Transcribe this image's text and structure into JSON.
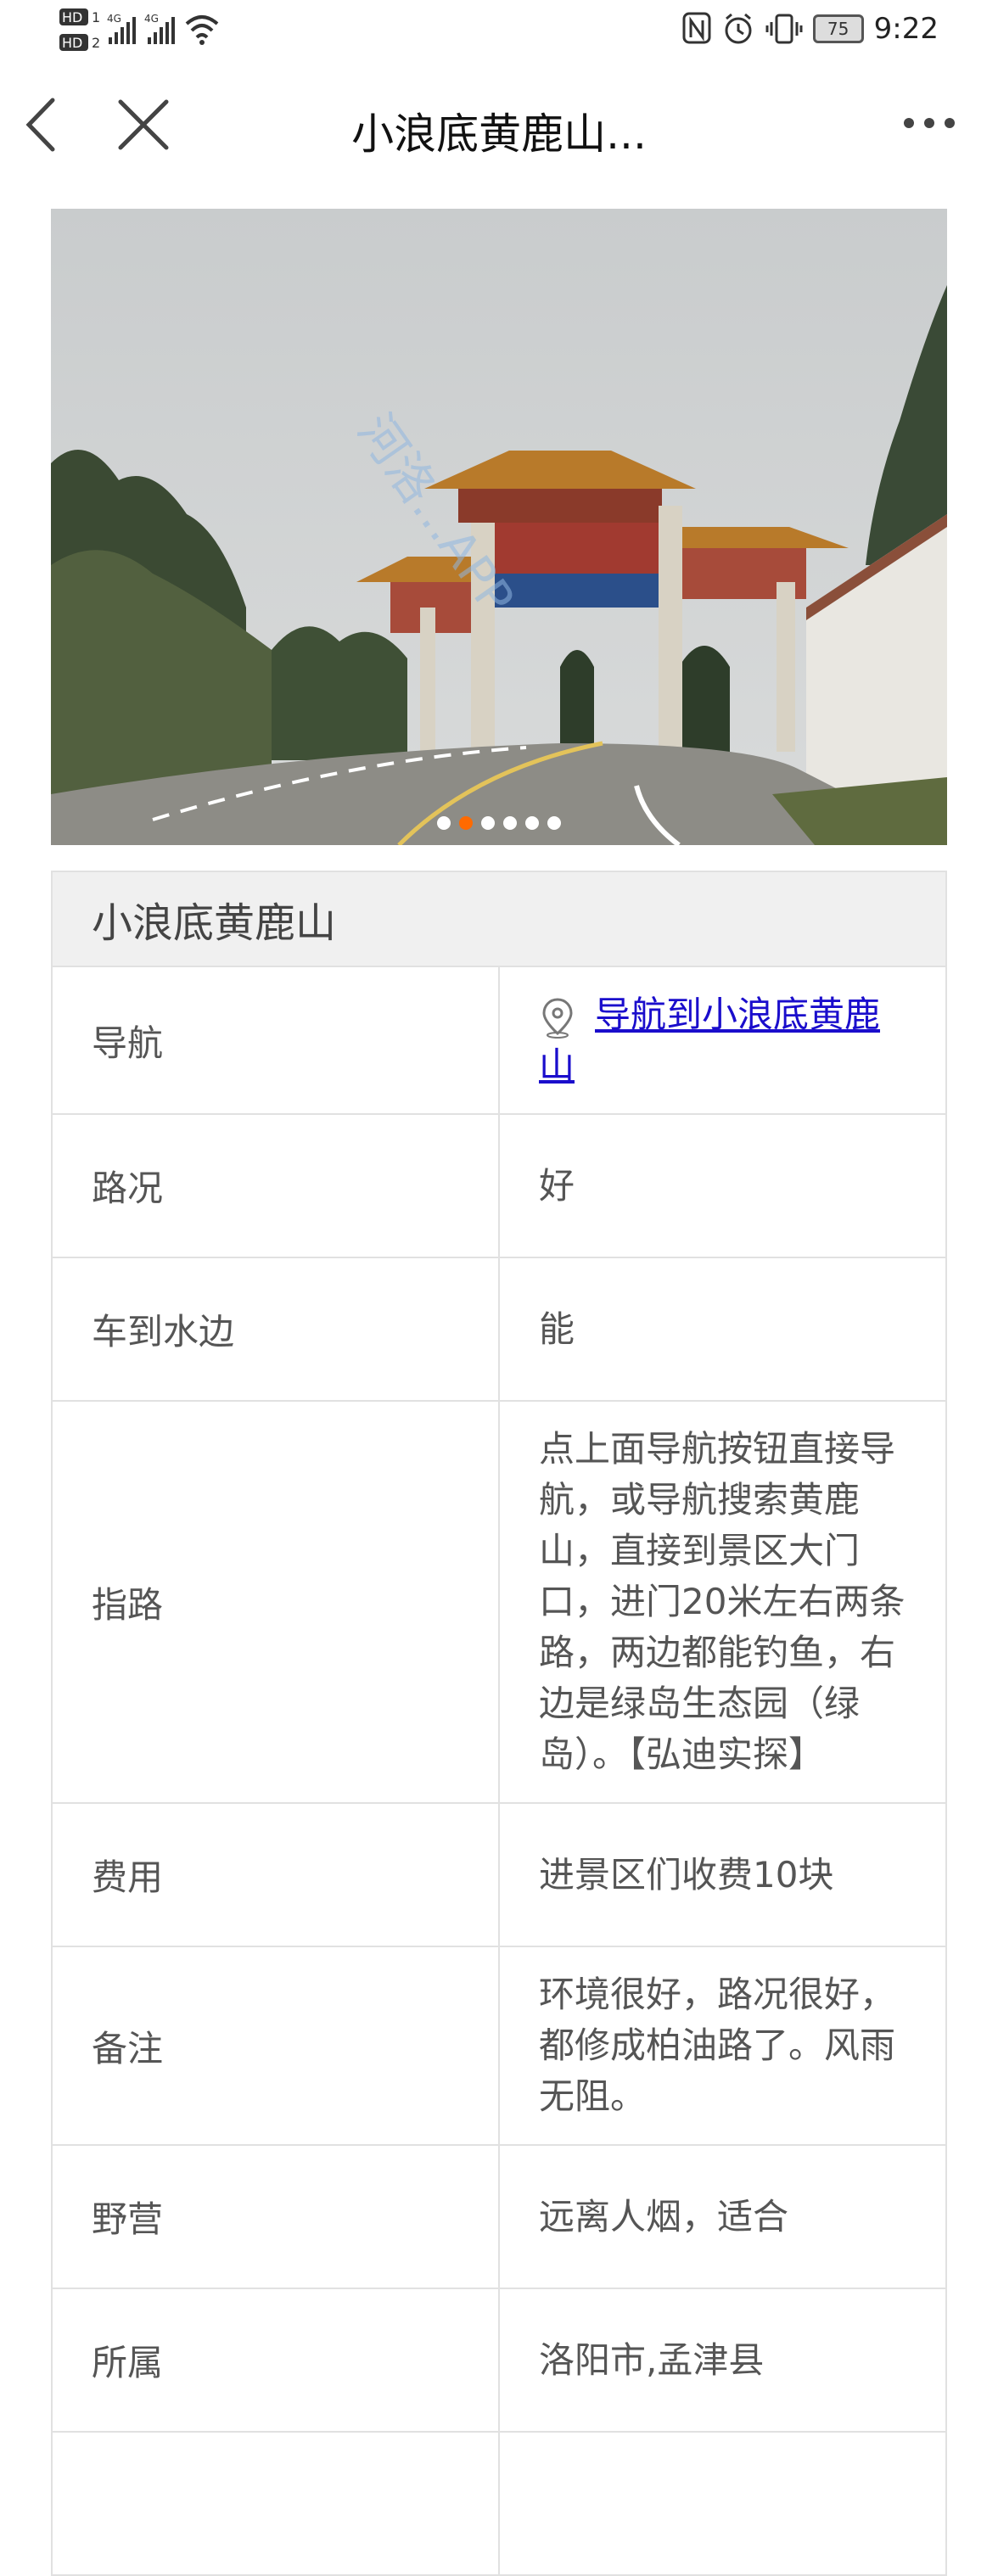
{
  "status_bar": {
    "network_left": "HD₁ 4G 4G",
    "time": "9:22",
    "battery": "75"
  },
  "nav": {
    "title": "小浪底黄鹿山..."
  },
  "gallery": {
    "watermark": "河洛...APP",
    "dots": [
      {
        "active": false
      },
      {
        "active": true
      },
      {
        "active": false
      },
      {
        "active": false
      },
      {
        "active": false
      },
      {
        "active": false
      }
    ]
  },
  "spot": {
    "title": "小浪底黄鹿山",
    "rows": [
      {
        "label": "导航",
        "value": "导航到小浪底黄鹿山",
        "is_link": true
      },
      {
        "label": "路况",
        "value": "好"
      },
      {
        "label": "车到水边",
        "value": "能"
      },
      {
        "label": "指路",
        "value": "点上面导航按钮直接导航，或导航搜索黄鹿山，直接到景区大门口，进门20米左右两条路，两边都能钓鱼，右边是绿岛生态园（绿岛）。【弘迪实探】"
      },
      {
        "label": "费用",
        "value": "进景区们收费10块"
      },
      {
        "label": "备注",
        "value": "环境很好，路况很好，都修成柏油路了。风雨无阻。"
      },
      {
        "label": "野营",
        "value": "远离人烟，适合"
      },
      {
        "label": "所属",
        "value": "洛阳市,孟津县"
      }
    ]
  }
}
